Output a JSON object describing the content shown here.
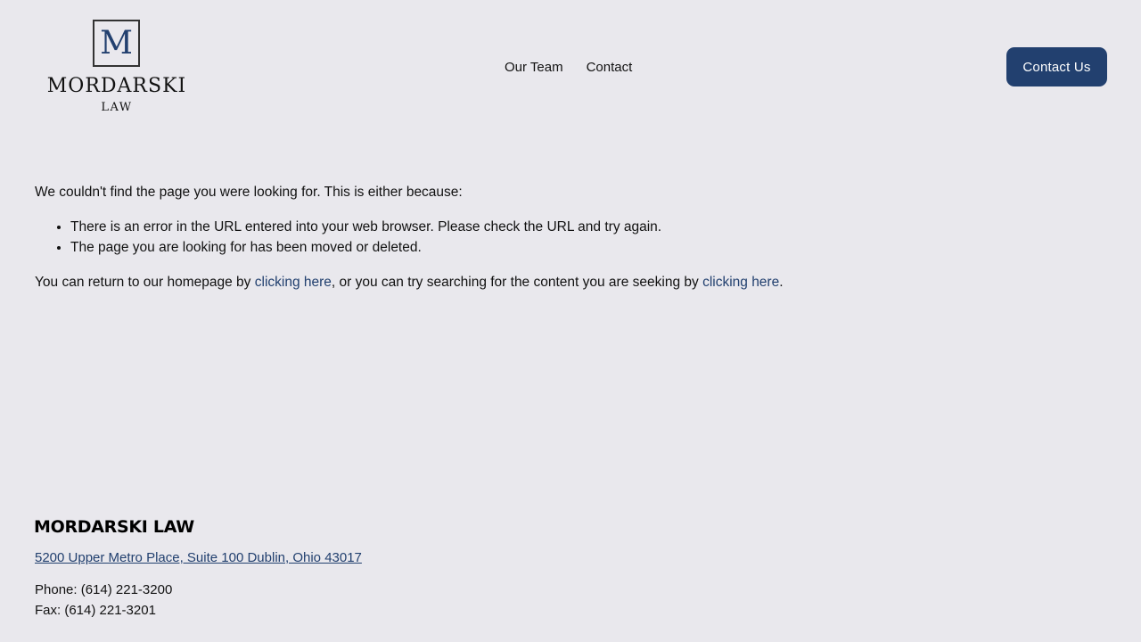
{
  "header": {
    "logo": {
      "letter": "M",
      "name": "MORDARSKI",
      "sub": "LAW"
    },
    "nav": [
      {
        "label": "Our Team"
      },
      {
        "label": "Contact"
      }
    ],
    "cta_label": "Contact Us",
    "accent_color": "#22406f"
  },
  "main": {
    "intro": "We couldn't find the page you were looking for. This is either because:",
    "reasons": [
      "There is an error in the URL entered into your web browser. Please check the URL and try again.",
      "The page you are looking for has been moved or deleted."
    ],
    "return_text_1": "You can return to our homepage by ",
    "home_link": "clicking here",
    "return_text_2": ", or you can try searching for the content you are seeking by ",
    "search_link": "clicking here",
    "return_text_3": "."
  },
  "footer": {
    "title": "MORDARSKI LAW",
    "address": "5200 Upper Metro Place, Suite 100 Dublin, Ohio 43017",
    "phone": "Phone: (614) 221-3200",
    "fax": "Fax: (614) 221-3201"
  }
}
